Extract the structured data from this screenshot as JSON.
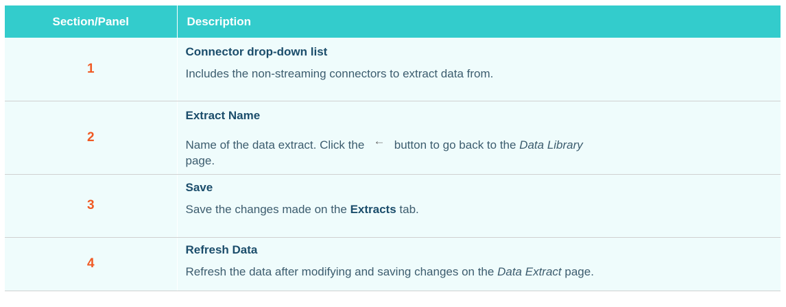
{
  "header": {
    "col1": "Section/Panel",
    "col2": "Description"
  },
  "rows": [
    {
      "number": "1",
      "title": "Connector drop-down list",
      "text": "Includes the non-streaming connectors to extract data from."
    },
    {
      "number": "2",
      "title": "Extract Name",
      "text_before": "Name of the data extract. Click the",
      "icon": "back-arrow-icon",
      "icon_glyph": "←",
      "text_middle": "button to go back to the",
      "text_italic": "Data Library",
      "text_after": "page."
    },
    {
      "number": "3",
      "title": "Save",
      "text_before": "Save the changes made on the",
      "text_bold": "Extracts",
      "text_after": "tab."
    },
    {
      "number": "4",
      "title": "Refresh Data",
      "text_before": "Refresh the data after modifying and saving changes on the",
      "text_italic": "Data Extract",
      "text_after": "page."
    }
  ],
  "colors": {
    "header_bg": "#33cccc",
    "row_bg": "#effcfc",
    "number": "#f05a24",
    "title": "#1b4d6b"
  }
}
